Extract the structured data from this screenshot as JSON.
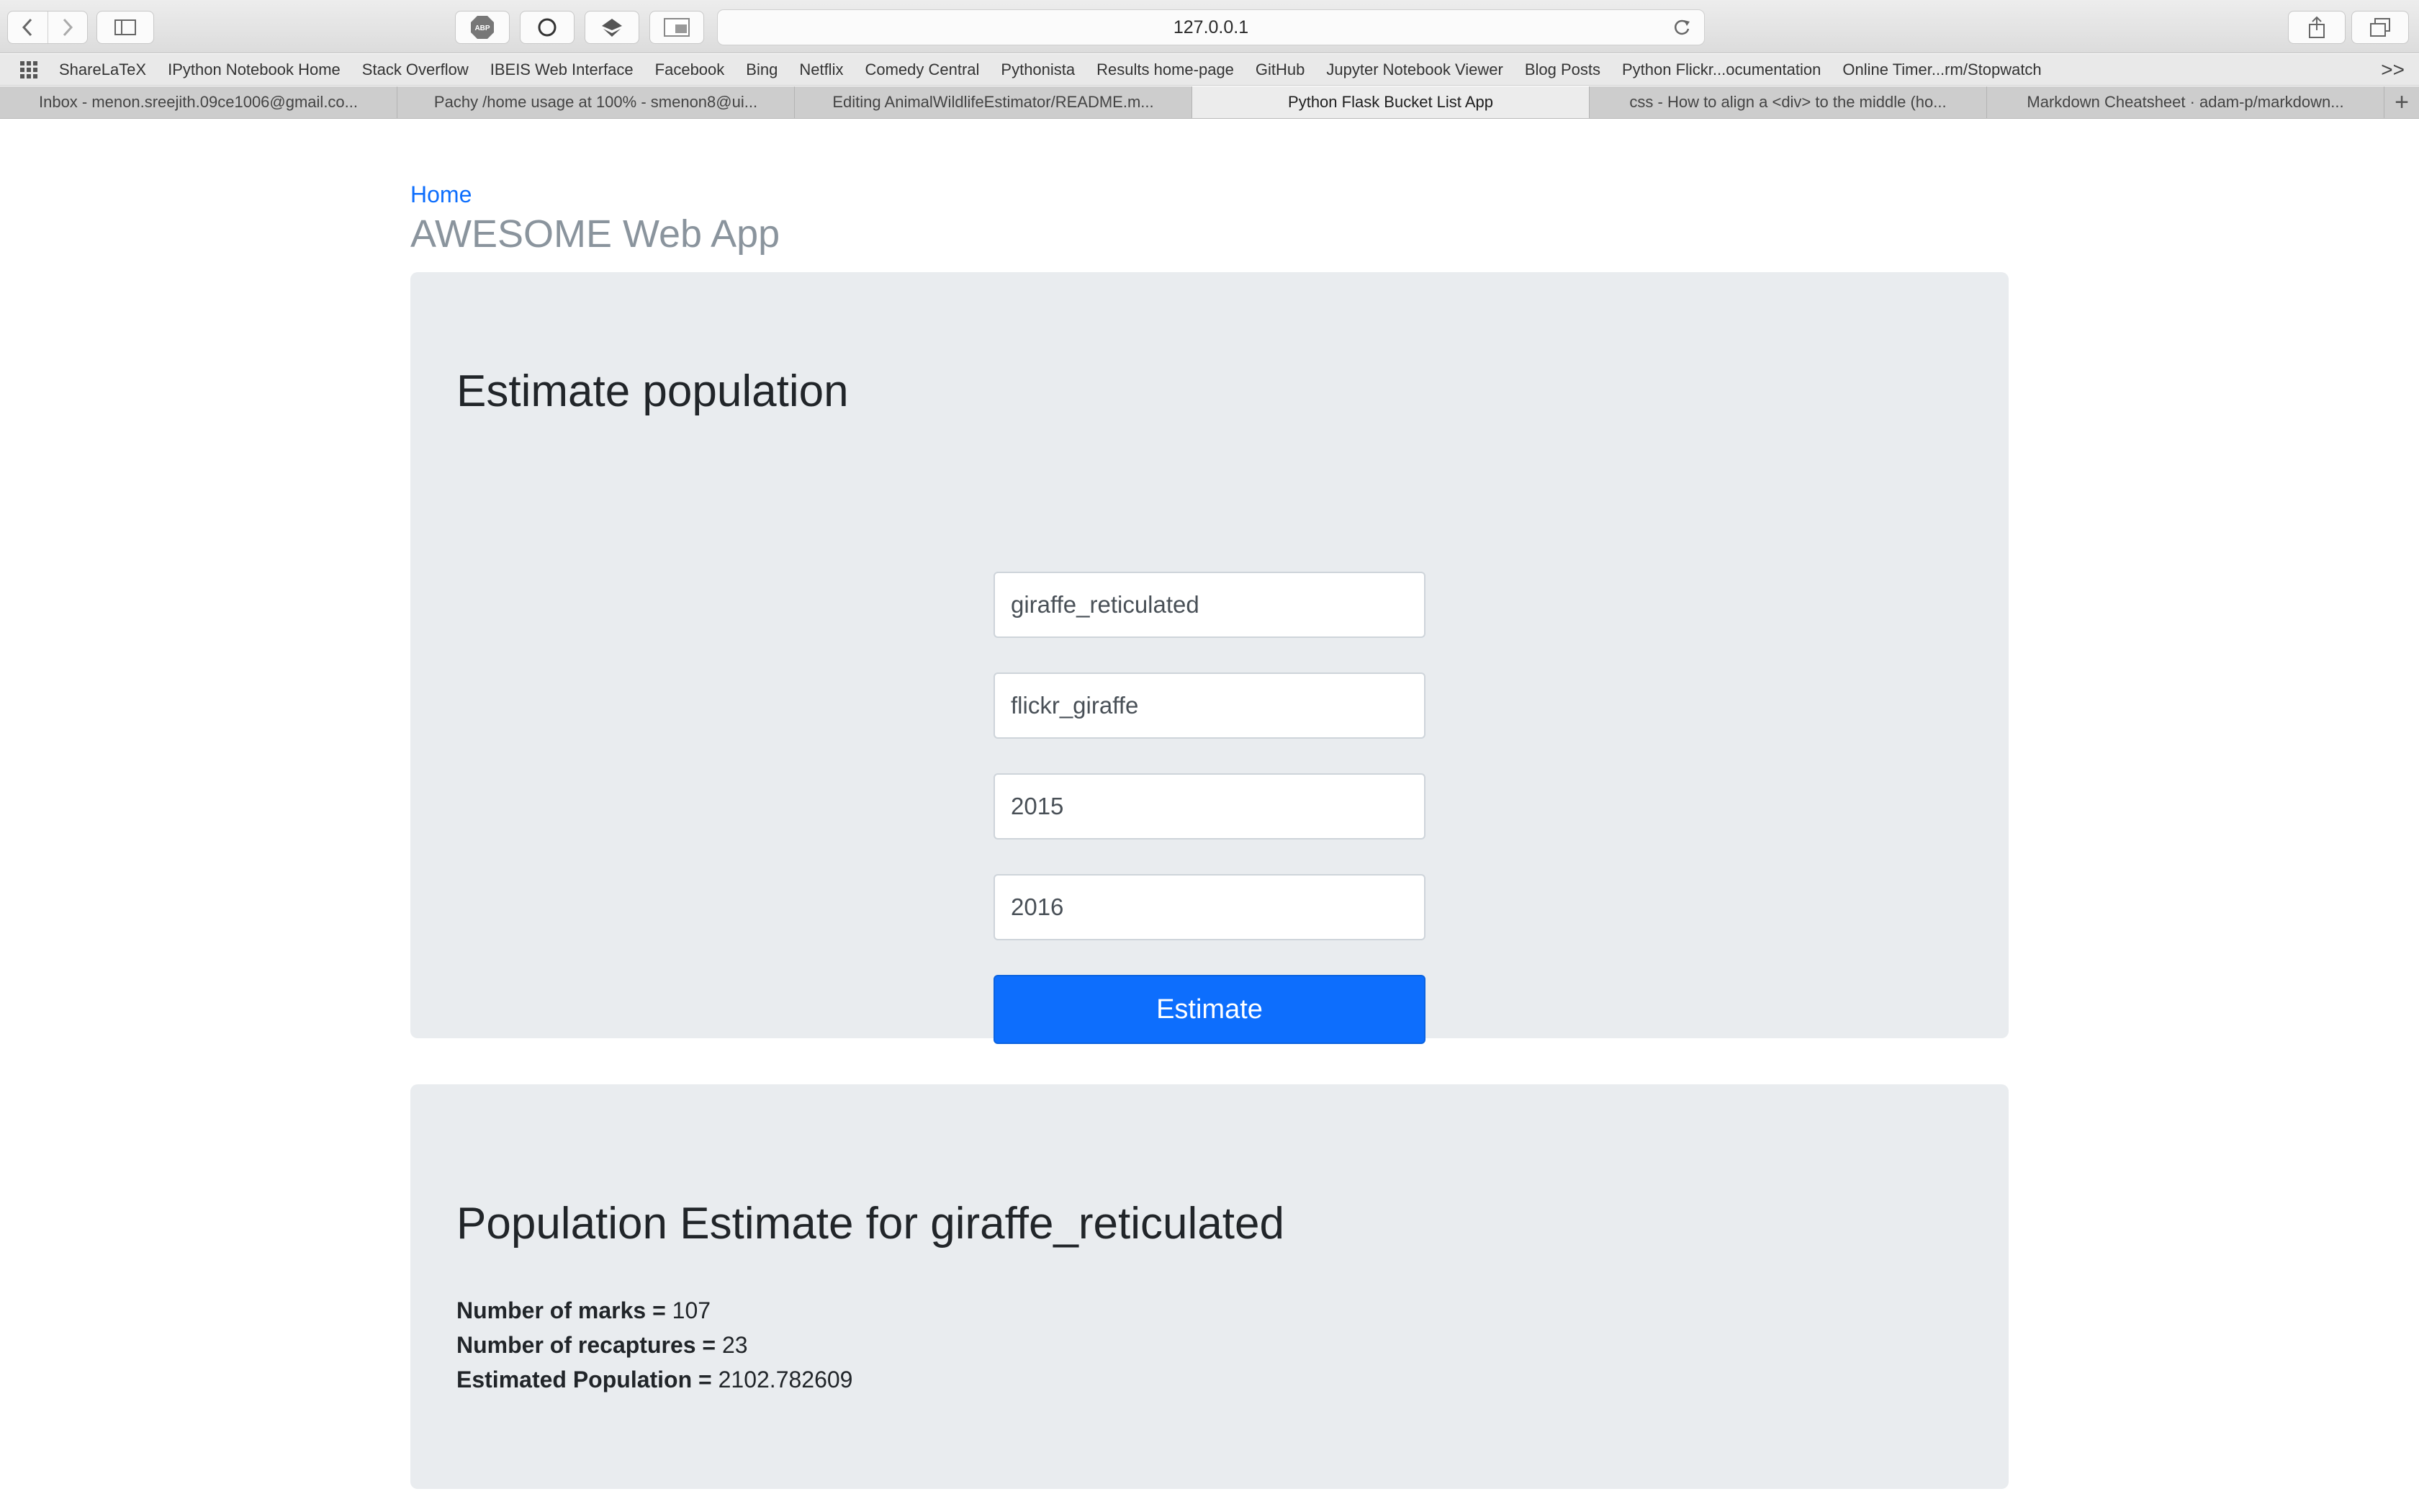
{
  "browser": {
    "url": "127.0.0.1",
    "bookmarks": [
      "ShareLaTeX",
      "IPython Notebook Home",
      "Stack Overflow",
      "IBEIS Web Interface",
      "Facebook",
      "Bing",
      "Netflix",
      "Comedy Central",
      "Pythonista",
      "Results home-page",
      "GitHub",
      "Jupyter Notebook Viewer",
      "Blog Posts",
      "Python Flickr...ocumentation",
      "Online Timer...rm/Stopwatch"
    ],
    "bookmarks_overflow": ">>",
    "tabs": [
      "Inbox - menon.sreejith.09ce1006@gmail.co...",
      "Pachy /home usage at 100% - smenon8@ui...",
      "Editing AnimalWildlifeEstimator/README.m...",
      "Python Flask Bucket List App",
      "css - How to align a <div> to the middle (ho...",
      "Markdown Cheatsheet · adam-p/markdown..."
    ],
    "active_tab_index": 3,
    "new_tab": "+",
    "icons": {
      "back": "chevron-left-icon",
      "forward": "chevron-right-icon",
      "sidebar": "sidebar-icon",
      "adblock": "abp-icon",
      "reload": "reload-icon",
      "share": "share-icon",
      "tabs": "tabs-overview-icon"
    },
    "abp_label": "ABP"
  },
  "page": {
    "home_link": "Home",
    "app_title": "AWESOME Web App",
    "form": {
      "heading": "Estimate population",
      "fields": [
        {
          "value": "giraffe_reticulated"
        },
        {
          "value": "flickr_giraffe"
        },
        {
          "value": "2015"
        },
        {
          "value": "2016"
        }
      ],
      "button": "Estimate",
      "accent_color": "#0d6efd"
    },
    "result": {
      "heading": "Population Estimate for giraffe_reticulated",
      "marks_label": "Number of marks = ",
      "marks_value": "107",
      "recaptures_label": "Number of recaptures = ",
      "recaptures_value": "23",
      "population_label": "Estimated Population = ",
      "population_value": "2102.782609"
    }
  }
}
